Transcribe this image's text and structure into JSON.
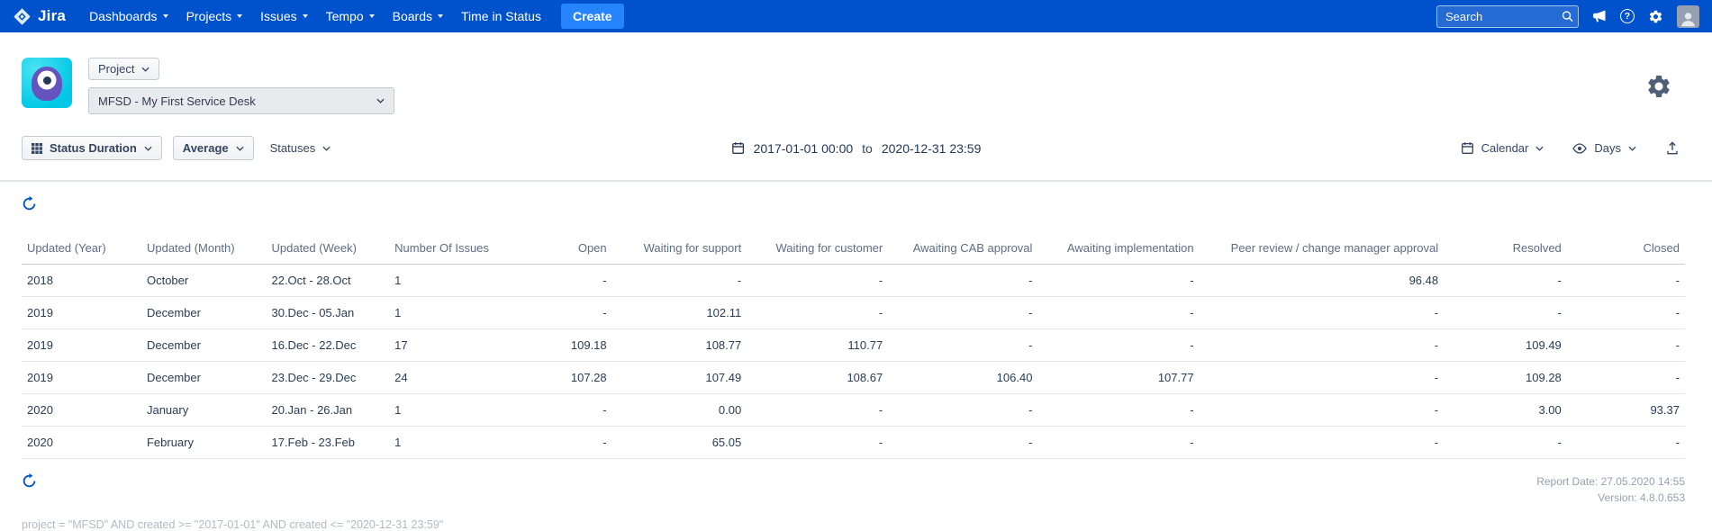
{
  "nav": {
    "brand": "Jira",
    "items": [
      "Dashboards",
      "Projects",
      "Issues",
      "Tempo",
      "Boards",
      "Time in Status"
    ],
    "create_label": "Create",
    "search_placeholder": "Search",
    "help_glyph": "?"
  },
  "project_header": {
    "project_button_label": "Project",
    "project_select_value": "MFSD - My First Service Desk"
  },
  "toolbar": {
    "report_type_label": "Status Duration",
    "aggregation_label": "Average",
    "statuses_label": "Statuses",
    "date_from": "2017-01-01 00:00",
    "date_separator": "to",
    "date_to": "2020-12-31 23:59",
    "calendar_label": "Calendar",
    "unit_label": "Days"
  },
  "table": {
    "columns": [
      "Updated (Year)",
      "Updated (Month)",
      "Updated (Week)",
      "Number Of Issues",
      "Open",
      "Waiting for support",
      "Waiting for customer",
      "Awaiting CAB approval",
      "Awaiting implementation",
      "Peer review / change manager approval",
      "Resolved",
      "Closed"
    ],
    "rows": [
      [
        "2018",
        "October",
        "22.Oct - 28.Oct",
        "1",
        "-",
        "-",
        "-",
        "-",
        "-",
        "96.48",
        "-",
        "-"
      ],
      [
        "2019",
        "December",
        "30.Dec - 05.Jan",
        "1",
        "-",
        "102.11",
        "-",
        "-",
        "-",
        "-",
        "-",
        "-"
      ],
      [
        "2019",
        "December",
        "16.Dec - 22.Dec",
        "17",
        "109.18",
        "108.77",
        "110.77",
        "-",
        "-",
        "-",
        "109.49",
        "-"
      ],
      [
        "2019",
        "December",
        "23.Dec - 29.Dec",
        "24",
        "107.28",
        "107.49",
        "108.67",
        "106.40",
        "107.77",
        "-",
        "109.28",
        "-"
      ],
      [
        "2020",
        "January",
        "20.Jan - 26.Jan",
        "1",
        "-",
        "0.00",
        "-",
        "-",
        "-",
        "-",
        "3.00",
        "93.37"
      ],
      [
        "2020",
        "February",
        "17.Feb - 23.Feb",
        "1",
        "-",
        "65.05",
        "-",
        "-",
        "-",
        "-",
        "-",
        "-"
      ]
    ]
  },
  "footer": {
    "report_date": "Report Date: 27.05.2020 14:55",
    "version": "Version: 4.8.0.653",
    "query": "project = \"MFSD\" AND created >= \"2017-01-01\" AND created <= \"2020-12-31 23:59\""
  },
  "colors": {
    "nav_blue": "#0052CC",
    "create_blue": "#2684FF",
    "accent_blue": "#0052CC",
    "avatar_teal": "#00C7E5",
    "avatar_purple": "#6554C0",
    "header_text": "#5E6C84",
    "muted_text": "#97A0AF"
  }
}
